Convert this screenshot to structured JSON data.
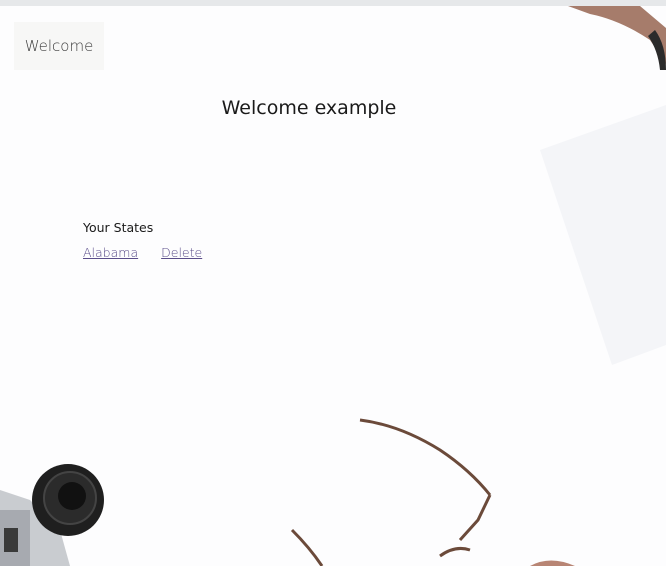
{
  "nav": {
    "welcome_tab": "Welcome"
  },
  "main": {
    "title": "Welcome example",
    "states": {
      "heading": "Your States",
      "items": [
        {
          "name": "Alabama",
          "delete_label": "Delete"
        }
      ]
    }
  },
  "background": {
    "description_icons": [
      "camera-icon",
      "eyeglasses-icon",
      "paper-sheet",
      "hand"
    ]
  }
}
